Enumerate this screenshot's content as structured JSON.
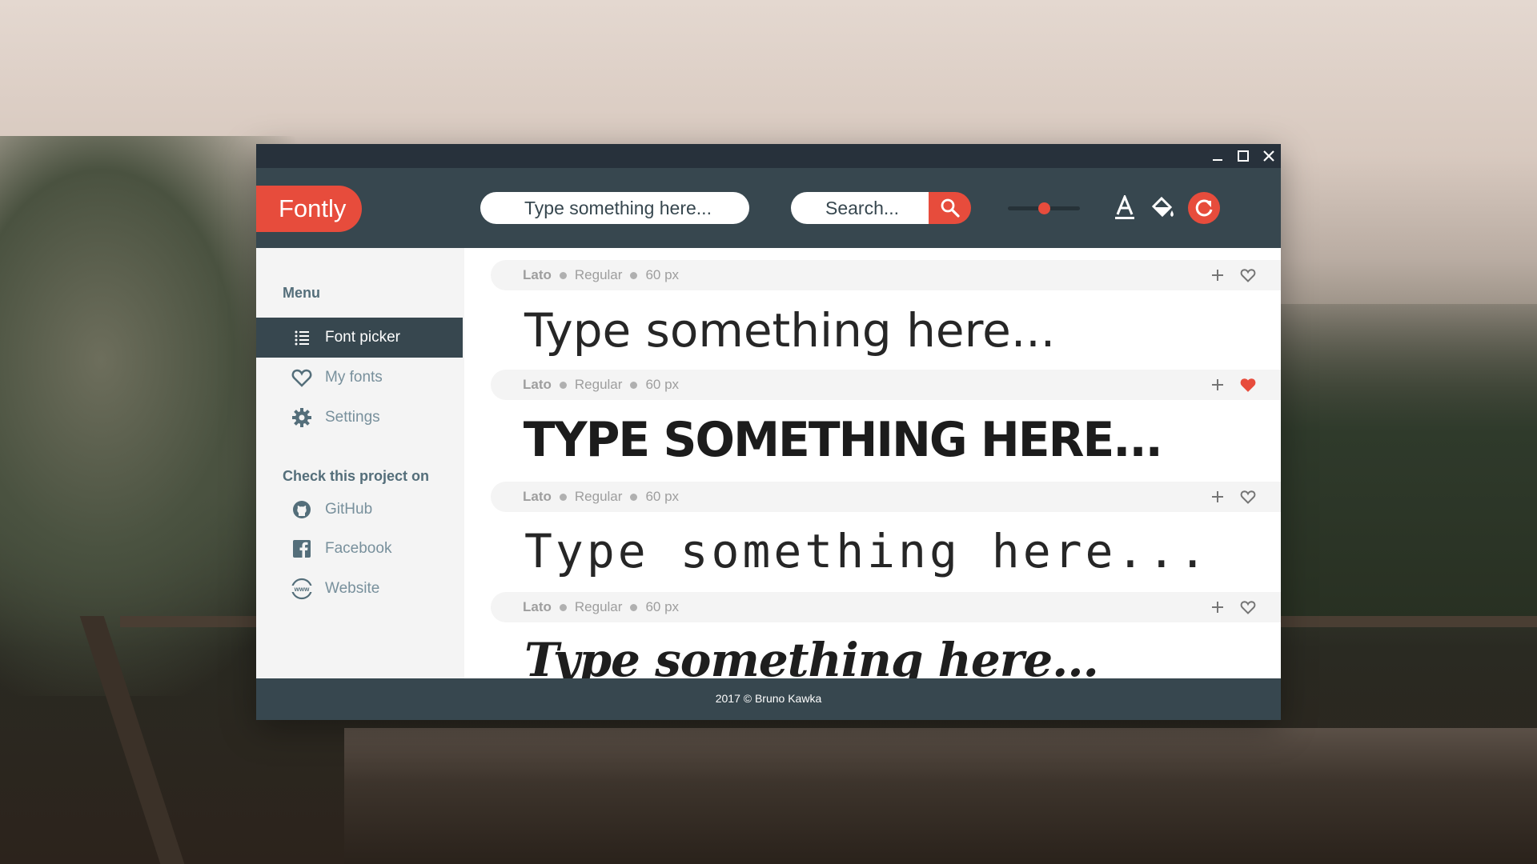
{
  "app": {
    "name": "Fontly",
    "accent_color": "#e74c3c",
    "dark_color": "#37474f"
  },
  "window_controls": [
    "minimize-icon",
    "maximize-icon",
    "close-icon"
  ],
  "toolbar": {
    "preview_placeholder": "Type something here...",
    "search_placeholder": "Search...",
    "search_icon": "search-icon",
    "size_slider_value": 0.5,
    "tools": [
      "text-color-icon",
      "paint-bucket-icon",
      "refresh-icon"
    ]
  },
  "sidebar": {
    "menu_title": "Menu",
    "items": [
      {
        "label": "Font picker",
        "icon": "list-icon",
        "active": true
      },
      {
        "label": "My fonts",
        "icon": "heart-icon",
        "active": false
      },
      {
        "label": "Settings",
        "icon": "gear-icon",
        "active": false
      }
    ],
    "check_title": "Check this project on",
    "links": [
      {
        "label": "GitHub",
        "icon": "github-icon"
      },
      {
        "label": "Facebook",
        "icon": "facebook-icon"
      },
      {
        "label": "Website",
        "icon": "www-icon"
      }
    ]
  },
  "fonts": [
    {
      "family": "Lato",
      "style": "Regular",
      "size": "60 px",
      "sample": "Type something here...",
      "favorite": false
    },
    {
      "family": "Lato",
      "style": "Regular",
      "size": "60 px",
      "sample": "Type something here...",
      "favorite": true
    },
    {
      "family": "Lato",
      "style": "Regular",
      "size": "60 px",
      "sample": "Type something here...",
      "favorite": false
    },
    {
      "family": "Lato",
      "style": "Regular",
      "size": "60 px",
      "sample": "Type something here...",
      "favorite": false
    }
  ],
  "footer": {
    "text": "2017 © Bruno Kawka"
  }
}
